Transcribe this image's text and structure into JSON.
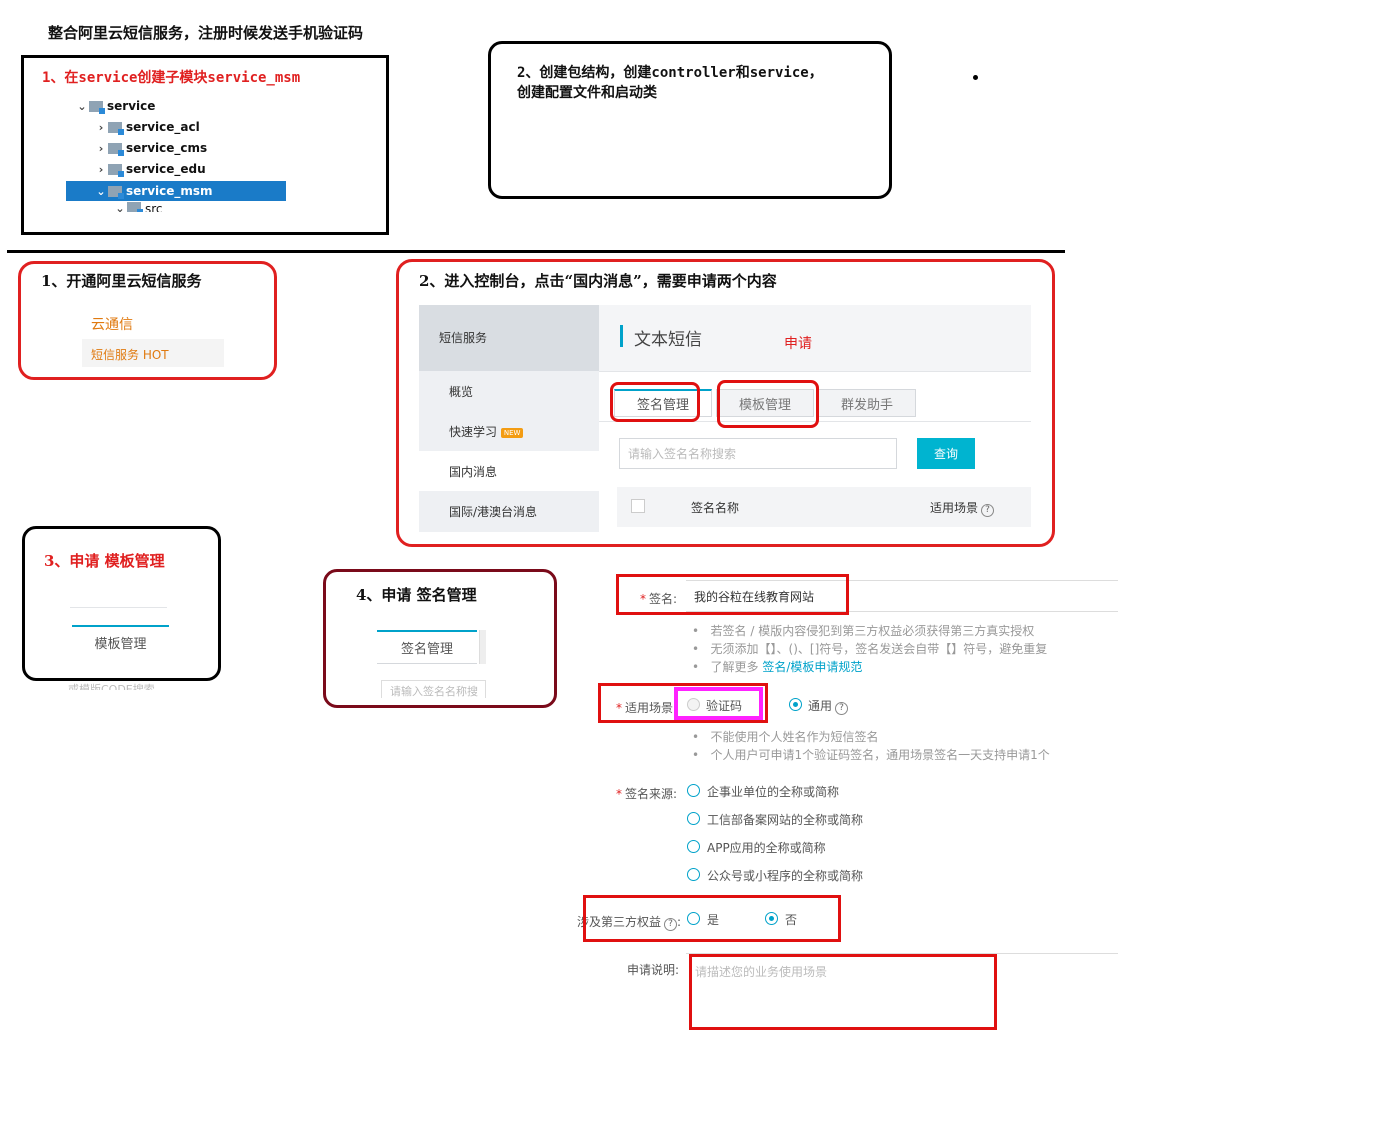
{
  "main_title": "整合阿里云短信服务，注册时候发送手机验证码",
  "step_create_module": {
    "title": "1、在service创建子模块service_msm",
    "tree": [
      "service",
      "service_acl",
      "service_cms",
      "service_edu",
      "service_msm",
      "src"
    ]
  },
  "step_create_structure": {
    "line1": "2、创建包结构，创建controller和service，",
    "line2": "创建配置文件和启动类"
  },
  "open_service": {
    "title": "1、开通阿里云短信服务",
    "item1": "云通信",
    "item2": "短信服务 HOT"
  },
  "console_panel": {
    "title": "2、进入控制台，点击“国内消息”，需要申请两个内容",
    "sidebar_header": "短信服务",
    "nav": [
      "概览",
      "快速学习",
      "国内消息",
      "国际/港澳台消息"
    ],
    "new_badge": "NEW",
    "page_heading": "文本短信",
    "apply_note": "申请",
    "tabs": [
      "签名管理",
      "模板管理",
      "群发助手"
    ],
    "search_placeholder": "请输入签名名称搜索",
    "search_button": "查询",
    "col_name": "签名名称",
    "col_scene": "适用场景"
  },
  "apply_template": {
    "title": "3、申请 模板管理",
    "tab": "模板管理",
    "cut_text": "或模版CODE搜索"
  },
  "apply_signature": {
    "title": "4、申请 签名管理",
    "tab": "签名管理",
    "cut_text": "请输入签名名称搜"
  },
  "form": {
    "sign_label": "签名:",
    "sign_value": "我的谷粒在线教育网站",
    "tips": [
      "若签名 / 模版内容侵犯到第三方权益必须获得第三方真实授权",
      "无须添加【】、()、[]符号，签名发送会自带【】符号，避免重复"
    ],
    "tip3_prefix": "了解更多 ",
    "tip3_link": "签名/模板申请规范",
    "scene_label": "适用场景:",
    "scene_opt1": "验证码",
    "scene_opt2": "通用",
    "scene_tips": [
      "不能使用个人姓名作为短信签名",
      "个人用户可申请1个验证码签名，通用场景签名一天支持申请1个"
    ],
    "source_label": "签名来源:",
    "sources": [
      "企事业单位的全称或简称",
      "工信部备案网站的全称或简称",
      "APP应用的全称或简称",
      "公众号或小程序的全称或简称"
    ],
    "third_party_label": "涉及第三方权益",
    "yes": "是",
    "no": "否",
    "desc_label": "申请说明:",
    "desc_placeholder": "请描述您的业务使用场景"
  }
}
